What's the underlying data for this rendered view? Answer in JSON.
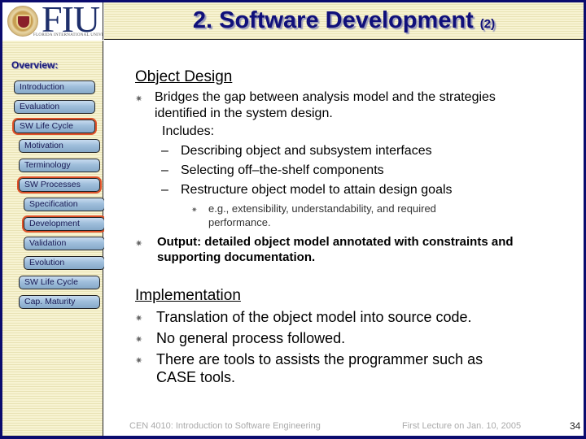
{
  "header": {
    "logo_text": "FIU",
    "logo_subtitle": "FLORIDA INTERNATIONAL UNIVERSITY",
    "title": "2. Software Development",
    "title_suffix": "(2)"
  },
  "sidebar": {
    "heading": "Overview:",
    "items": [
      {
        "label": "Introduction",
        "active": false
      },
      {
        "label": "Evaluation",
        "active": false
      },
      {
        "label": "SW Life Cycle",
        "active": true
      },
      {
        "label": "Motivation",
        "active": false
      },
      {
        "label": "Terminology",
        "active": false
      },
      {
        "label": "SW Processes",
        "active": true
      },
      {
        "label": "Specification",
        "active": false
      },
      {
        "label": "Development",
        "active": true
      },
      {
        "label": "Validation",
        "active": false
      },
      {
        "label": "Evolution",
        "active": false
      },
      {
        "label": "SW Life Cycle",
        "active": false
      },
      {
        "label": "Cap. Maturity",
        "active": false
      }
    ]
  },
  "content": {
    "object_design": {
      "heading": "Object Design",
      "bullet1_line1": "Bridges the gap between analysis model and the strategies",
      "bullet1_line2": "identified in the system design.",
      "includes": "Includes:",
      "dashes": [
        "Describing object and subsystem interfaces",
        "Selecting off–the-shelf components",
        "Restructure object model to attain design goals"
      ],
      "subsub_line1": "e.g., extensibility, understandability, and required",
      "subsub_line2": "performance.",
      "bullet2_line1": "Output: detailed object model annotated with constraints and",
      "bullet2_line2": "supporting documentation."
    },
    "implementation": {
      "heading": "Implementation",
      "bullets": [
        "Translation of the object model into source code.",
        "No general process followed.",
        "There are tools to assists the programmer such as"
      ],
      "bullet3_line2": "CASE tools."
    }
  },
  "footer": {
    "course": "CEN 4010: Introduction to Software Engineering",
    "date": "First Lecture on Jan. 10, 2005",
    "page": "34"
  }
}
